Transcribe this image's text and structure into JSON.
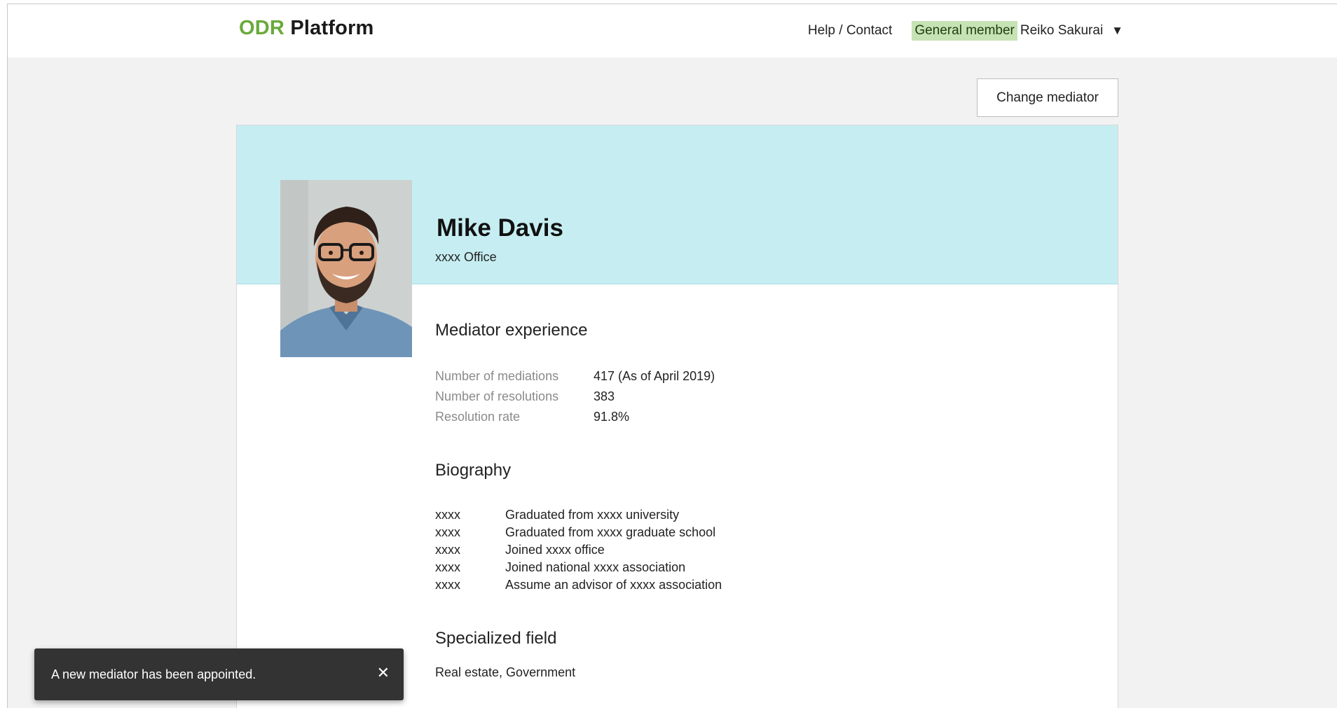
{
  "header": {
    "logo_odr": "ODR",
    "logo_platform": "Platform",
    "help_label": "Help / Contact",
    "member_badge": "General member",
    "user_name": "Reiko Sakurai",
    "dropdown_icon": "▼"
  },
  "toolbar": {
    "change_mediator_label": "Change mediator"
  },
  "profile": {
    "name": "Mike Davis",
    "office": "xxxx Office",
    "photo_icon": "mediator-photo"
  },
  "experience": {
    "title": "Mediator experience",
    "rows": [
      {
        "label": "Number of mediations",
        "value": "417 (As of April 2019)"
      },
      {
        "label": "Number of resolutions",
        "value": "383"
      },
      {
        "label": "Resolution rate",
        "value": "91.8%"
      }
    ]
  },
  "biography": {
    "title": "Biography",
    "rows": [
      {
        "year": "xxxx",
        "text": "Graduated from xxxx university"
      },
      {
        "year": "xxxx",
        "text": "Graduated from xxxx graduate school"
      },
      {
        "year": "xxxx",
        "text": "Joined xxxx office"
      },
      {
        "year": "xxxx",
        "text": "Joined national xxxx association"
      },
      {
        "year": "xxxx",
        "text": "Assume an advisor of xxxx association"
      }
    ]
  },
  "specialized": {
    "title": "Specialized field",
    "text": "Real estate, Government"
  },
  "snackbar": {
    "message": "A new mediator has been appointed.",
    "close_icon": "✕"
  },
  "colors": {
    "brand_green": "#6aaa3c",
    "banner": "#c6eef2",
    "badge": "#c5e3b4",
    "snackbar": "#333333"
  }
}
